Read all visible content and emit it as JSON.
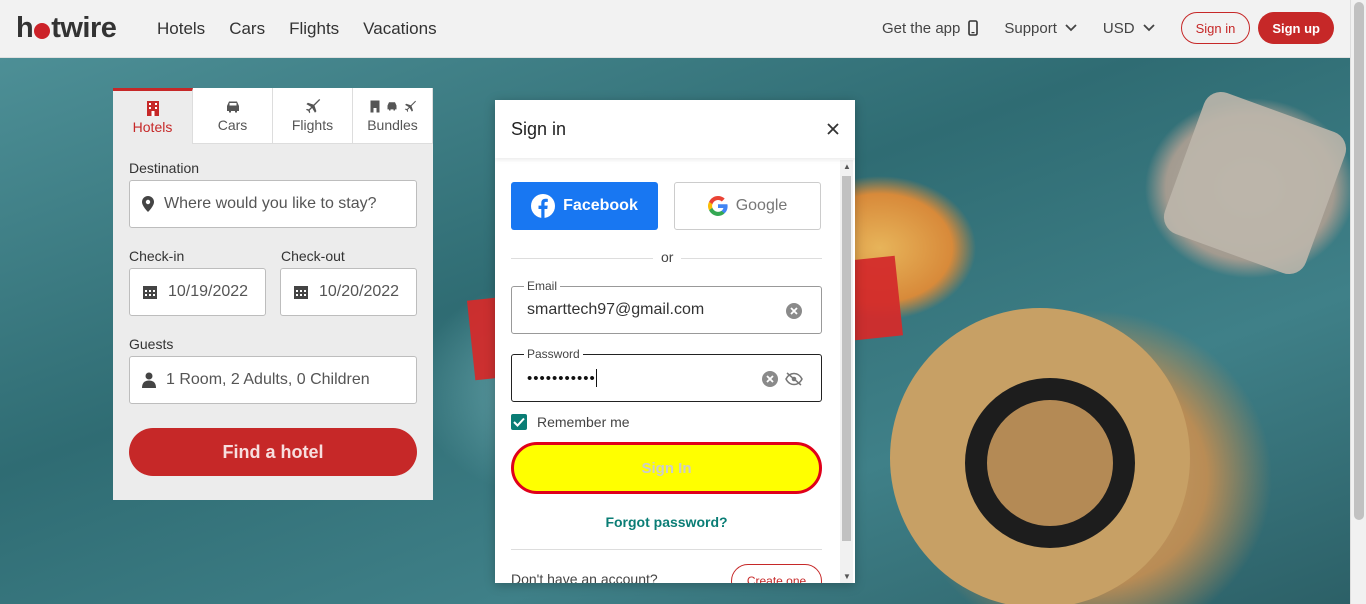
{
  "header": {
    "logo_text_pre": "h",
    "logo_text_post": "twire",
    "nav": [
      "Hotels",
      "Cars",
      "Flights",
      "Vacations"
    ],
    "get_app": "Get the app",
    "support": "Support",
    "currency": "USD",
    "sign_in": "Sign in",
    "sign_up": "Sign up"
  },
  "search": {
    "tabs": [
      {
        "label": "Hotels",
        "icon": "hotel-icon"
      },
      {
        "label": "Cars",
        "icon": "car-icon"
      },
      {
        "label": "Flights",
        "icon": "plane-icon"
      },
      {
        "label": "Bundles",
        "icon": "bundles-icon"
      }
    ],
    "destination_label": "Destination",
    "destination_placeholder": "Where would you like to stay?",
    "checkin_label": "Check-in",
    "checkin_value": "10/19/2022",
    "checkout_label": "Check-out",
    "checkout_value": "10/20/2022",
    "guests_label": "Guests",
    "guests_value": "1 Room, 2 Adults, 0 Children",
    "find_button": "Find a hotel"
  },
  "modal": {
    "title": "Sign in",
    "facebook": "Facebook",
    "google": "Google",
    "or": "or",
    "email_label": "Email",
    "email_value": "smarttech97@gmail.com",
    "password_label": "Password",
    "password_value": "•••••••••••",
    "remember_me": "Remember me",
    "remember_checked": true,
    "sign_in_button": "Sign In",
    "forgot_password": "Forgot password?",
    "no_account": "Don't have an account?",
    "create_one": "Create one"
  },
  "colors": {
    "brand_red": "#c62828",
    "facebook_blue": "#1877f2",
    "teal": "#0a7d75",
    "highlight_yellow": "#ffff00"
  }
}
